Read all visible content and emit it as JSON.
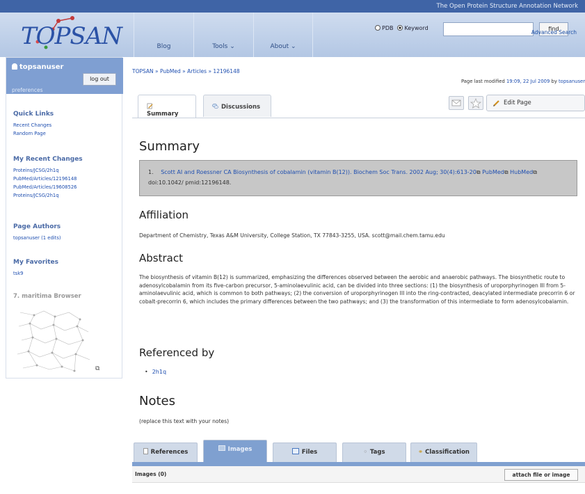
{
  "header": {
    "network_title": "The Open Protein Structure Annotation Network",
    "logo_text": "TOPSAN",
    "nav": [
      "Blog",
      "Tools ⌄",
      "About ⌄"
    ],
    "search": {
      "pdb_label": "PDB",
      "keyword_label": "Keyword",
      "selected": "Keyword",
      "value": "",
      "find_label": "find",
      "advanced_label": "Advanced Search"
    }
  },
  "sidebar": {
    "username": "topsanuser",
    "logout_label": "log out",
    "preferences_label": "preferences",
    "quick_links": {
      "title": "Quick Links",
      "items": [
        "Recent Changes",
        "Random Page"
      ]
    },
    "recent_changes": {
      "title": "My Recent Changes",
      "items": [
        "Proteins/JCSG/2h1q",
        "PubMed/Articles/12196148",
        "PubMed/Articles/19608526",
        "Proteins/JCSG/2h1q"
      ]
    },
    "page_authors": {
      "title": "Page Authors",
      "items": [
        "topsanuser (1 edits)"
      ]
    },
    "favorites": {
      "title": "My Favorites",
      "items": [
        "tsk9"
      ]
    },
    "browser": {
      "title": "7. maritima Browser"
    }
  },
  "main": {
    "breadcrumb": "TOPSAN » PubMed » Articles » 12196148",
    "modified_prefix": "Page last modified",
    "modified_date": "19:09, 22 Jul 2009",
    "modified_by_prefix": "by",
    "modified_user": "topsanuser",
    "tabs": [
      "Summary",
      "Discussions"
    ],
    "edit_label": "Edit Page",
    "summary_title": "Summary",
    "reference": {
      "number": "1.",
      "citation": "Scott AI and Roessner CA Biosynthesis of cobalamin (vitamin B(12)). Biochem Soc Trans. 2002 Aug; 30(4):613-20",
      "pubmed": "PubMed",
      "hubmed": "HubMed",
      "ids": "doi:10.1042/ pmid:12196148."
    },
    "affiliation_title": "Affiliation",
    "affiliation_text": "Department of Chemistry, Texas A&M University, College Station, TX 77843-3255, USA. scott@mail.chem.tamu.edu",
    "abstract_title": "Abstract",
    "abstract_text": "The biosynthesis of vitamin B(12) is summarized, emphasizing the differences observed between the aerobic and anaerobic pathways. The biosynthetic route to adenosylcobalamin from its five-carbon precursor, 5-aminolaevulinic acid, can be divided into three sections: (1) the biosynthesis of uroporphyrinogen III from 5-aminolaevulinic acid, which is common to both pathways; (2) the conversion of uroporphyrinogen III into the ring-contracted, deacylated intermediate precorrin 6 or cobalt-precorrin 6, which includes the primary differences between the two pathways; and (3) the transformation of this intermediate to form adenosylcobalamin.",
    "referenced_title": "Referenced by",
    "referenced_items": [
      "2h1q"
    ],
    "notes_title": "Notes",
    "notes_text": "(replace this text with your notes)"
  },
  "bottom_tabs": {
    "items": [
      "References",
      "Images",
      "Files",
      "Tags",
      "Classification"
    ],
    "active": "Images",
    "images_count_label": "Images (0)",
    "attach_label": "attach file or image"
  },
  "colors": {
    "accent": "#7fa0d0",
    "header_strip": "#3f64a6",
    "link": "#1f4fb0",
    "reference_bg": "#c7c7c7"
  }
}
